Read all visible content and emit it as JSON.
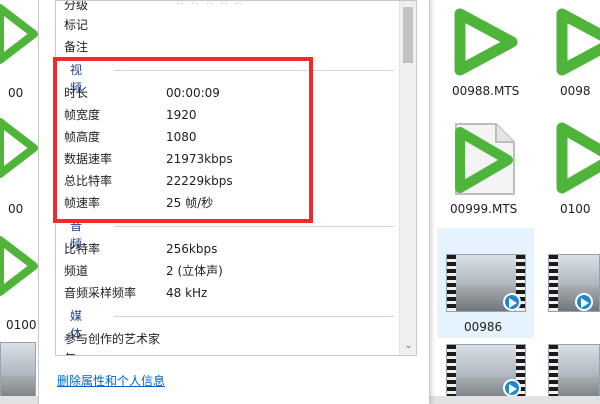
{
  "panel": {
    "top_rows": [
      {
        "key": "分级"
      },
      {
        "key": "标记"
      },
      {
        "key": "备注"
      }
    ],
    "rating_stars": "☆☆☆☆☆",
    "sections": {
      "video": "视频",
      "audio": "音频",
      "media": "媒体"
    },
    "video": [
      {
        "key": "时长",
        "value": "00:00:09"
      },
      {
        "key": "帧宽度",
        "value": "1920"
      },
      {
        "key": "帧高度",
        "value": "1080"
      },
      {
        "key": "数据速率",
        "value": "21973kbps"
      },
      {
        "key": "总比特率",
        "value": "22229kbps"
      },
      {
        "key": "帧速率",
        "value": "25 帧/秒"
      }
    ],
    "audio": [
      {
        "key": "比特率",
        "value": "256kbps"
      },
      {
        "key": "频道",
        "value": "2 (立体声)"
      },
      {
        "key": "音频采样频率",
        "value": "48 kHz"
      }
    ],
    "media": [
      {
        "key": "参与创作的艺术家"
      },
      {
        "key": "年"
      }
    ],
    "remove_link": "删除属性和个人信息",
    "scroll_down_glyph": "⌄"
  },
  "explorer": {
    "labels": {
      "left_top": "00",
      "left_mid": "00",
      "left_bottom": "0100",
      "file_988": "00988.MTS",
      "file_989_partial": "0098",
      "file_999": "00999.MTS",
      "file_1000_partial": "0100",
      "file_986": "00986"
    },
    "accent": "#4fb53a",
    "highlight_color": "#ee2b2b",
    "link_color": "#0066cc"
  }
}
